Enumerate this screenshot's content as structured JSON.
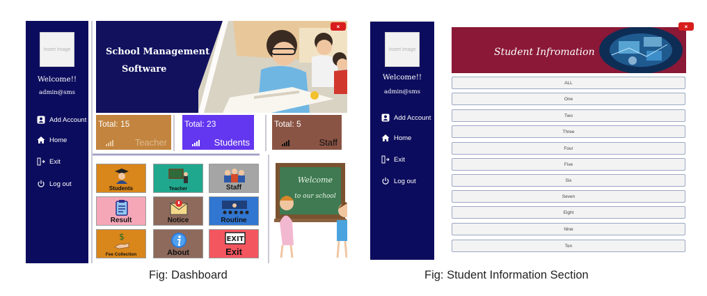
{
  "dashboard": {
    "sidebar": {
      "image_placeholder": "Insert Image",
      "welcome": "Welcome!!",
      "email": "admin@sms",
      "nav": [
        {
          "label": "Add Account",
          "icon": "account-icon"
        },
        {
          "label": "Home",
          "icon": "home-icon"
        },
        {
          "label": "Exit",
          "icon": "exit-door-icon"
        },
        {
          "label": "Log out",
          "icon": "power-icon"
        }
      ]
    },
    "banner": {
      "line1": "School Management",
      "line2": "Software"
    },
    "close_label": "×",
    "stats": [
      {
        "total": "Total: 15",
        "label": "Teacher",
        "color": "#c2843f"
      },
      {
        "total": "Total: 23",
        "label": "Students",
        "color": "#6336f0"
      },
      {
        "total": "Total: 5",
        "label": "Staff",
        "color": "#8a5444"
      }
    ],
    "tiles": [
      {
        "label": "Students",
        "color": "#d9861a"
      },
      {
        "label": "Teacher",
        "color": "#20a88e"
      },
      {
        "label": "Staff",
        "color": "#a5a5a5"
      },
      {
        "label": "Result",
        "color": "#f5a7b8"
      },
      {
        "label": "Notice",
        "color": "#8e6a5c"
      },
      {
        "label": "Routine",
        "color": "#3176d1"
      },
      {
        "label": "Fee Collection",
        "color": "#d9861a"
      },
      {
        "label": "About",
        "color": "#8e6a5c"
      },
      {
        "label": "Exit",
        "color": "#f4565f"
      }
    ],
    "board": {
      "line1": "Welcome",
      "line2": "to our school"
    }
  },
  "info": {
    "sidebar": {
      "image_placeholder": "Insert Image",
      "welcome": "Welcome!!",
      "email": "admin@sms",
      "nav": [
        {
          "label": "Add Account",
          "icon": "account-icon"
        },
        {
          "label": "Home",
          "icon": "home-icon"
        },
        {
          "label": "Exit",
          "icon": "exit-door-icon"
        },
        {
          "label": "Log out",
          "icon": "power-icon"
        }
      ]
    },
    "banner_title": "Student Infromation",
    "close_label": "×",
    "classes": [
      "ALL",
      "One",
      "Two",
      "Three",
      "Four",
      "Five",
      "Six",
      "Seven",
      "Eight",
      "Nine",
      "Ten"
    ]
  },
  "captions": {
    "left": "Fig: Dashboard",
    "right": "Fig: Student Information Section"
  }
}
